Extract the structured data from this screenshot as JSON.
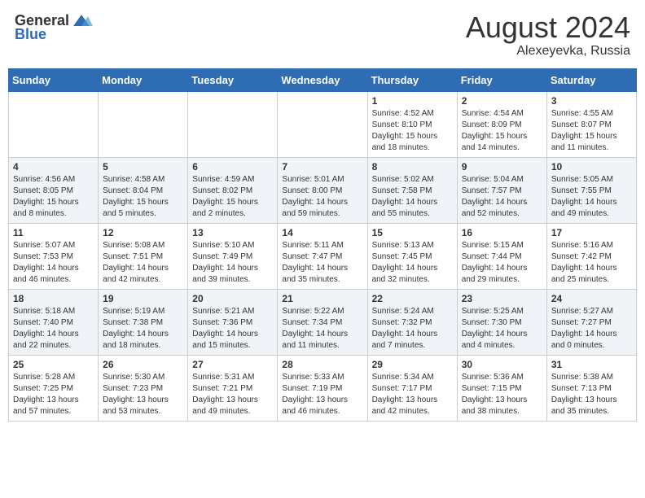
{
  "header": {
    "logo_general": "General",
    "logo_blue": "Blue",
    "main_title": "August 2024",
    "subtitle": "Alexeyevka, Russia"
  },
  "calendar": {
    "days_of_week": [
      "Sunday",
      "Monday",
      "Tuesday",
      "Wednesday",
      "Thursday",
      "Friday",
      "Saturday"
    ],
    "weeks": [
      [
        {
          "day": "",
          "info": ""
        },
        {
          "day": "",
          "info": ""
        },
        {
          "day": "",
          "info": ""
        },
        {
          "day": "",
          "info": ""
        },
        {
          "day": "1",
          "info": "Sunrise: 4:52 AM\nSunset: 8:10 PM\nDaylight: 15 hours\nand 18 minutes."
        },
        {
          "day": "2",
          "info": "Sunrise: 4:54 AM\nSunset: 8:09 PM\nDaylight: 15 hours\nand 14 minutes."
        },
        {
          "day": "3",
          "info": "Sunrise: 4:55 AM\nSunset: 8:07 PM\nDaylight: 15 hours\nand 11 minutes."
        }
      ],
      [
        {
          "day": "4",
          "info": "Sunrise: 4:56 AM\nSunset: 8:05 PM\nDaylight: 15 hours\nand 8 minutes."
        },
        {
          "day": "5",
          "info": "Sunrise: 4:58 AM\nSunset: 8:04 PM\nDaylight: 15 hours\nand 5 minutes."
        },
        {
          "day": "6",
          "info": "Sunrise: 4:59 AM\nSunset: 8:02 PM\nDaylight: 15 hours\nand 2 minutes."
        },
        {
          "day": "7",
          "info": "Sunrise: 5:01 AM\nSunset: 8:00 PM\nDaylight: 14 hours\nand 59 minutes."
        },
        {
          "day": "8",
          "info": "Sunrise: 5:02 AM\nSunset: 7:58 PM\nDaylight: 14 hours\nand 55 minutes."
        },
        {
          "day": "9",
          "info": "Sunrise: 5:04 AM\nSunset: 7:57 PM\nDaylight: 14 hours\nand 52 minutes."
        },
        {
          "day": "10",
          "info": "Sunrise: 5:05 AM\nSunset: 7:55 PM\nDaylight: 14 hours\nand 49 minutes."
        }
      ],
      [
        {
          "day": "11",
          "info": "Sunrise: 5:07 AM\nSunset: 7:53 PM\nDaylight: 14 hours\nand 46 minutes."
        },
        {
          "day": "12",
          "info": "Sunrise: 5:08 AM\nSunset: 7:51 PM\nDaylight: 14 hours\nand 42 minutes."
        },
        {
          "day": "13",
          "info": "Sunrise: 5:10 AM\nSunset: 7:49 PM\nDaylight: 14 hours\nand 39 minutes."
        },
        {
          "day": "14",
          "info": "Sunrise: 5:11 AM\nSunset: 7:47 PM\nDaylight: 14 hours\nand 35 minutes."
        },
        {
          "day": "15",
          "info": "Sunrise: 5:13 AM\nSunset: 7:45 PM\nDaylight: 14 hours\nand 32 minutes."
        },
        {
          "day": "16",
          "info": "Sunrise: 5:15 AM\nSunset: 7:44 PM\nDaylight: 14 hours\nand 29 minutes."
        },
        {
          "day": "17",
          "info": "Sunrise: 5:16 AM\nSunset: 7:42 PM\nDaylight: 14 hours\nand 25 minutes."
        }
      ],
      [
        {
          "day": "18",
          "info": "Sunrise: 5:18 AM\nSunset: 7:40 PM\nDaylight: 14 hours\nand 22 minutes."
        },
        {
          "day": "19",
          "info": "Sunrise: 5:19 AM\nSunset: 7:38 PM\nDaylight: 14 hours\nand 18 minutes."
        },
        {
          "day": "20",
          "info": "Sunrise: 5:21 AM\nSunset: 7:36 PM\nDaylight: 14 hours\nand 15 minutes."
        },
        {
          "day": "21",
          "info": "Sunrise: 5:22 AM\nSunset: 7:34 PM\nDaylight: 14 hours\nand 11 minutes."
        },
        {
          "day": "22",
          "info": "Sunrise: 5:24 AM\nSunset: 7:32 PM\nDaylight: 14 hours\nand 7 minutes."
        },
        {
          "day": "23",
          "info": "Sunrise: 5:25 AM\nSunset: 7:30 PM\nDaylight: 14 hours\nand 4 minutes."
        },
        {
          "day": "24",
          "info": "Sunrise: 5:27 AM\nSunset: 7:27 PM\nDaylight: 14 hours\nand 0 minutes."
        }
      ],
      [
        {
          "day": "25",
          "info": "Sunrise: 5:28 AM\nSunset: 7:25 PM\nDaylight: 13 hours\nand 57 minutes."
        },
        {
          "day": "26",
          "info": "Sunrise: 5:30 AM\nSunset: 7:23 PM\nDaylight: 13 hours\nand 53 minutes."
        },
        {
          "day": "27",
          "info": "Sunrise: 5:31 AM\nSunset: 7:21 PM\nDaylight: 13 hours\nand 49 minutes."
        },
        {
          "day": "28",
          "info": "Sunrise: 5:33 AM\nSunset: 7:19 PM\nDaylight: 13 hours\nand 46 minutes."
        },
        {
          "day": "29",
          "info": "Sunrise: 5:34 AM\nSunset: 7:17 PM\nDaylight: 13 hours\nand 42 minutes."
        },
        {
          "day": "30",
          "info": "Sunrise: 5:36 AM\nSunset: 7:15 PM\nDaylight: 13 hours\nand 38 minutes."
        },
        {
          "day": "31",
          "info": "Sunrise: 5:38 AM\nSunset: 7:13 PM\nDaylight: 13 hours\nand 35 minutes."
        }
      ]
    ]
  }
}
